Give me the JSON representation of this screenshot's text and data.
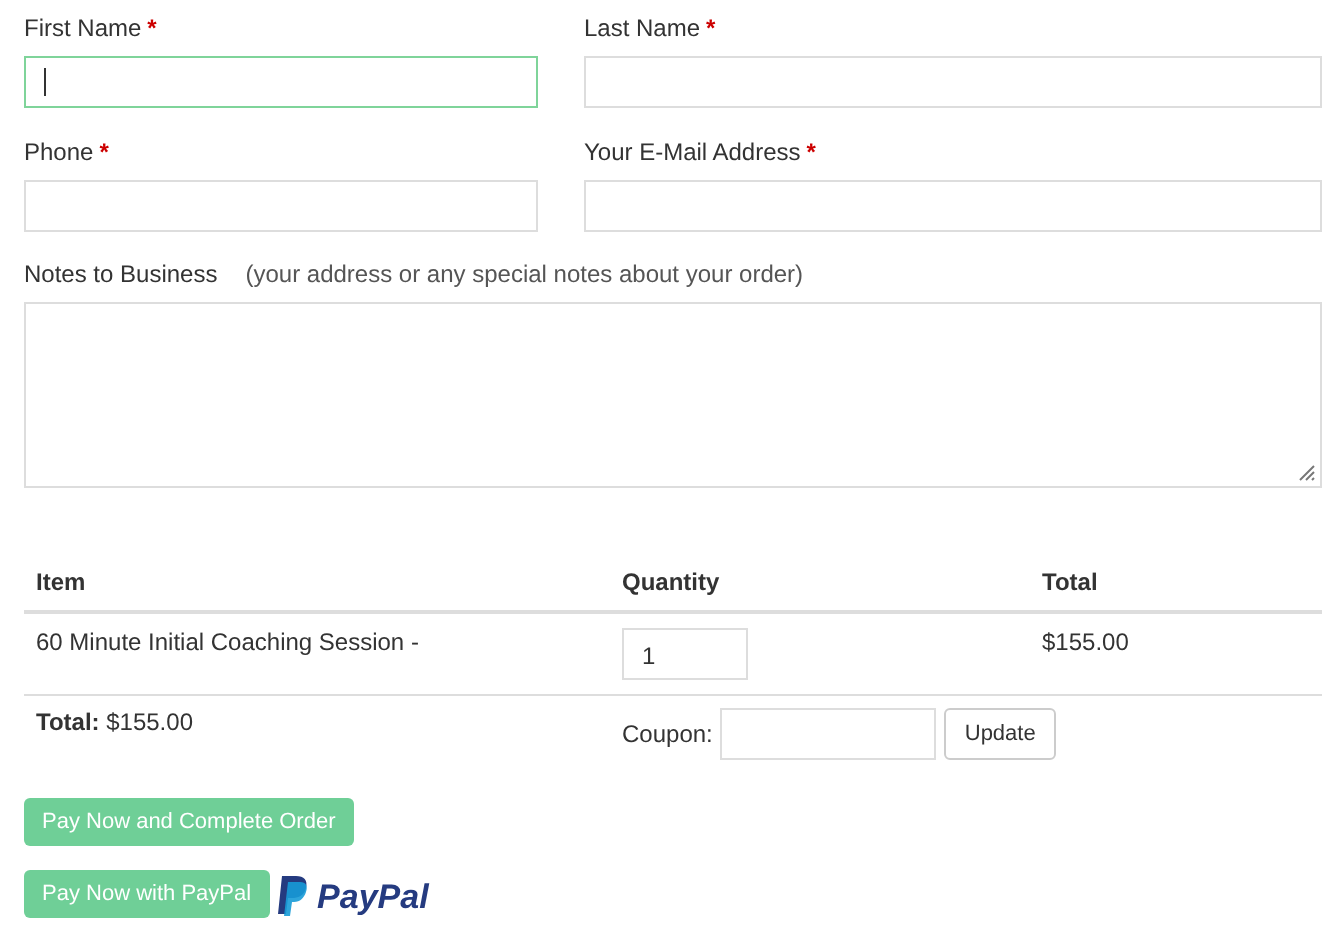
{
  "fields": [
    {
      "label": "First Name",
      "required_mark": "*",
      "focused": true
    },
    {
      "label": "Last Name",
      "required_mark": "*",
      "focused": false
    },
    {
      "label": "Phone",
      "required_mark": "*",
      "focused": false
    },
    {
      "label": "Your E-Mail Address",
      "required_mark": "*",
      "focused": false
    }
  ],
  "notes": {
    "label": "Notes to Business",
    "hint": "(your address or any special notes about your order)"
  },
  "table": {
    "columns": [
      "Item",
      "Quantity",
      "Total"
    ],
    "rows": [
      {
        "item": "60 Minute Initial Coaching Session -",
        "quantity": "1",
        "total": "$155.00"
      }
    ],
    "total": "**Total:** $155.00",
    "coupon_label": "Coupon:",
    "update_button": "Update"
  },
  "buttons": [
    {
      "label": "Pay Now and Complete Order",
      "kind": "plain"
    },
    {
      "label": "Pay Now with PayPal",
      "kind": "paypal",
      "logo": "PayPal"
    }
  ]
}
